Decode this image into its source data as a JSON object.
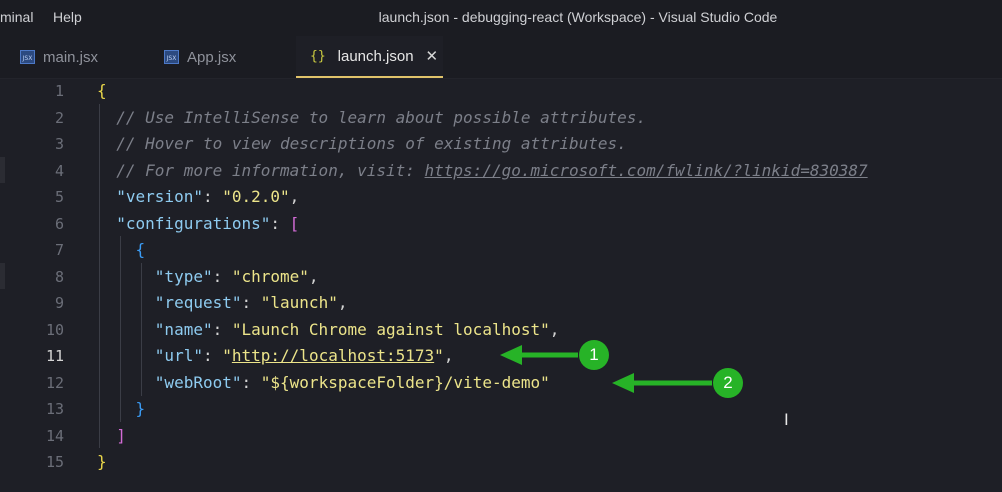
{
  "titlebar": {
    "menu": [
      "minal",
      "Help"
    ],
    "title": "launch.json - debugging-react (Workspace) - Visual Studio Code"
  },
  "tabs": [
    {
      "label": "main.jsx",
      "icon": "jsx-file-icon",
      "icon_text": "JSX",
      "active": false
    },
    {
      "label": "App.jsx",
      "icon": "jsx-file-icon",
      "icon_text": "JSX",
      "active": false
    },
    {
      "label": "launch.json",
      "icon": "json-file-icon",
      "icon_text": "{}",
      "active": true
    }
  ],
  "editor": {
    "active_line": 11,
    "line_numbers": [
      "1",
      "2",
      "3",
      "4",
      "5",
      "6",
      "7",
      "8",
      "9",
      "10",
      "11",
      "12",
      "13",
      "14",
      "15"
    ],
    "comments": {
      "l2": "// Use IntelliSense to learn about possible attributes.",
      "l3": "// Hover to view descriptions of existing attributes.",
      "l4_prefix": "// For more information, visit: ",
      "l4_link": "https://go.microsoft.com/fwlink/?linkid=830387"
    },
    "keys": {
      "version": "\"version\"",
      "configurations": "\"configurations\"",
      "type": "\"type\"",
      "request": "\"request\"",
      "name": "\"name\"",
      "url": "\"url\"",
      "webRoot": "\"webRoot\""
    },
    "values": {
      "version": "\"0.2.0\"",
      "type": "\"chrome\"",
      "request": "\"launch\"",
      "name": "\"Launch Chrome against localhost\"",
      "url_link": "http://localhost:5173",
      "webRoot": "\"${workspaceFolder}/vite-demo\""
    }
  },
  "annotations": [
    {
      "number": "1"
    },
    {
      "number": "2"
    }
  ],
  "colors": {
    "annotation_green": "#27b327",
    "bracket_yellow": "#e9d64a",
    "bracket_magenta": "#d36bd6",
    "bracket_blue": "#3b9cf5"
  }
}
